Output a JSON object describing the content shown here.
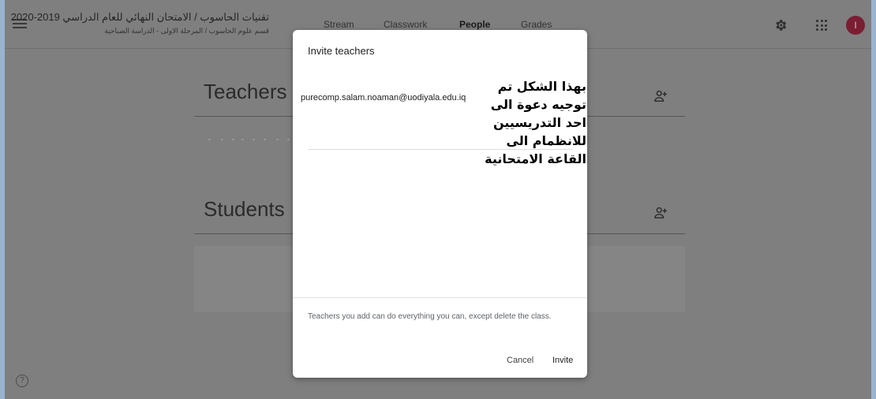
{
  "header": {
    "class_title": "تقنيات الحاسوب / الامتحان النهائي للعام الدراسي 2019-2020",
    "class_subtitle": "قسم علوم الحاسوب / المرحلة الاولى - الدراسة الصباحية",
    "tabs": [
      {
        "label": "Stream",
        "active": false
      },
      {
        "label": "Classwork",
        "active": false
      },
      {
        "label": "People",
        "active": true
      },
      {
        "label": "Grades",
        "active": false
      }
    ],
    "avatar_letter": "I"
  },
  "sections": {
    "teachers_title": "Teachers",
    "students_title": "Students"
  },
  "dialog": {
    "title": "Invite teachers",
    "email_value": "purecomp.salam.noaman@uodiyala.edu.iq",
    "annotation_lines": [
      "بهذا الشكل تم",
      "توجيه دعوة الى",
      "احد التدريسيين",
      "للانظمام الى",
      "القاعة الامتحانية"
    ],
    "footnote": "Teachers you add can do everything you can, except delete the class.",
    "cancel_label": "Cancel",
    "invite_label": "Invite"
  },
  "help_glyph": "?",
  "colors": {
    "avatar_bg": "#7a1e33",
    "overlay": "#7f7f7f",
    "dialog_bg": "#ffffff"
  },
  "icons": [
    "menu-icon",
    "gear-icon",
    "apps-icon",
    "add-person-icon",
    "help-icon"
  ]
}
